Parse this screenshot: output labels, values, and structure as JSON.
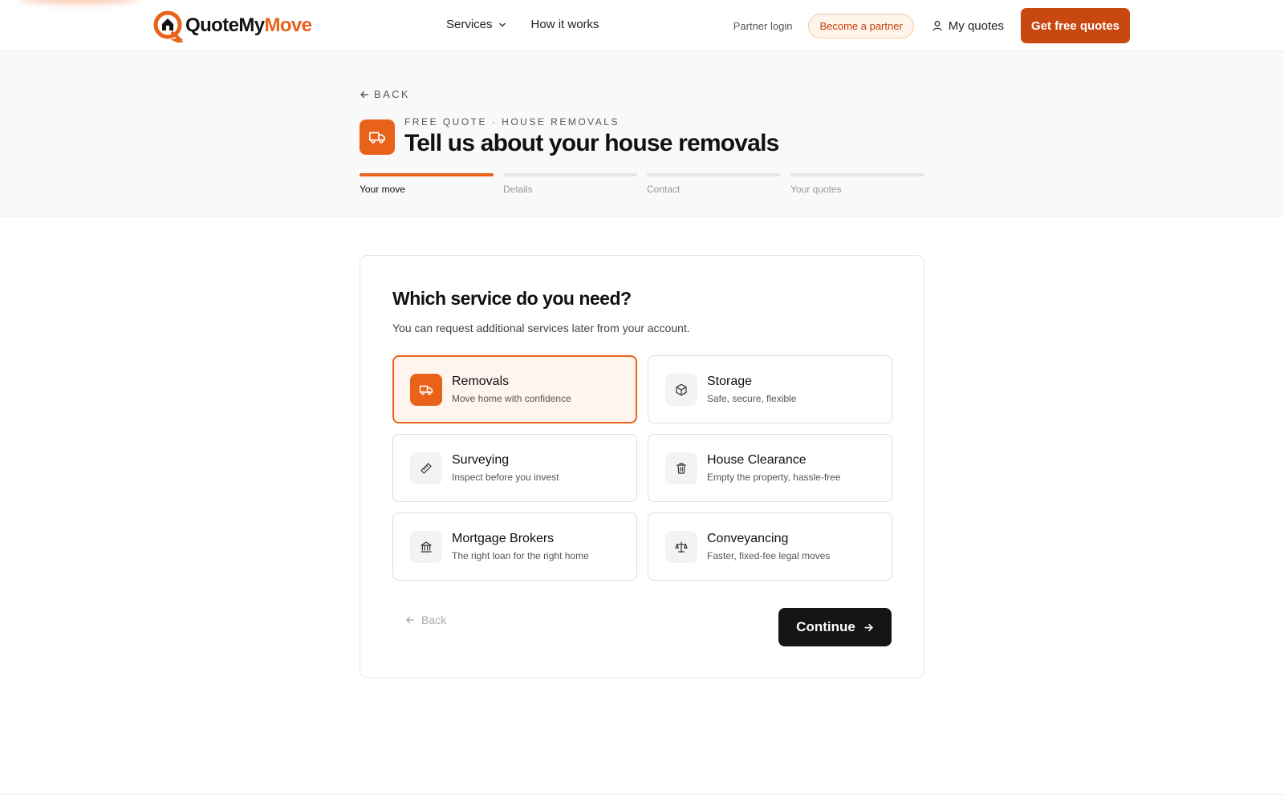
{
  "brand": {
    "name_part1": "QuoteMy",
    "name_part2": "Move",
    "accent": "#e8621a",
    "button_color": "#c94711"
  },
  "nav": {
    "services": "Services",
    "how_it_works": "How it works"
  },
  "header_right": {
    "partner_login": "Partner login",
    "become_partner": "Become a partner",
    "my_quotes": "My quotes",
    "get_quotes": "Get free quotes"
  },
  "hero": {
    "back": "BACK",
    "eyebrow": "FREE QUOTE · HOUSE REMOVALS",
    "title": "Tell us about your house removals",
    "icon": "truck-icon"
  },
  "steps": [
    {
      "label": "Your move",
      "active": true
    },
    {
      "label": "Details",
      "active": false
    },
    {
      "label": "Contact",
      "active": false
    },
    {
      "label": "Your quotes",
      "active": false
    }
  ],
  "card": {
    "title": "Which service do you need?",
    "subtitle": "You can request additional services later from your account.",
    "options": [
      {
        "title": "Removals",
        "desc": "Move home with confidence",
        "icon": "truck-icon",
        "selected": true
      },
      {
        "title": "Storage",
        "desc": "Safe, secure, flexible",
        "icon": "box-icon",
        "selected": false
      },
      {
        "title": "Surveying",
        "desc": "Inspect before you invest",
        "icon": "ruler-icon",
        "selected": false
      },
      {
        "title": "House Clearance",
        "desc": "Empty the property, hassle-free",
        "icon": "trash-icon",
        "selected": false
      },
      {
        "title": "Mortgage Brokers",
        "desc": "The right loan for the right home",
        "icon": "bank-icon",
        "selected": false
      },
      {
        "title": "Conveyancing",
        "desc": "Faster, fixed-fee legal moves",
        "icon": "scales-icon",
        "selected": false
      }
    ],
    "back": "Back",
    "continue": "Continue"
  }
}
